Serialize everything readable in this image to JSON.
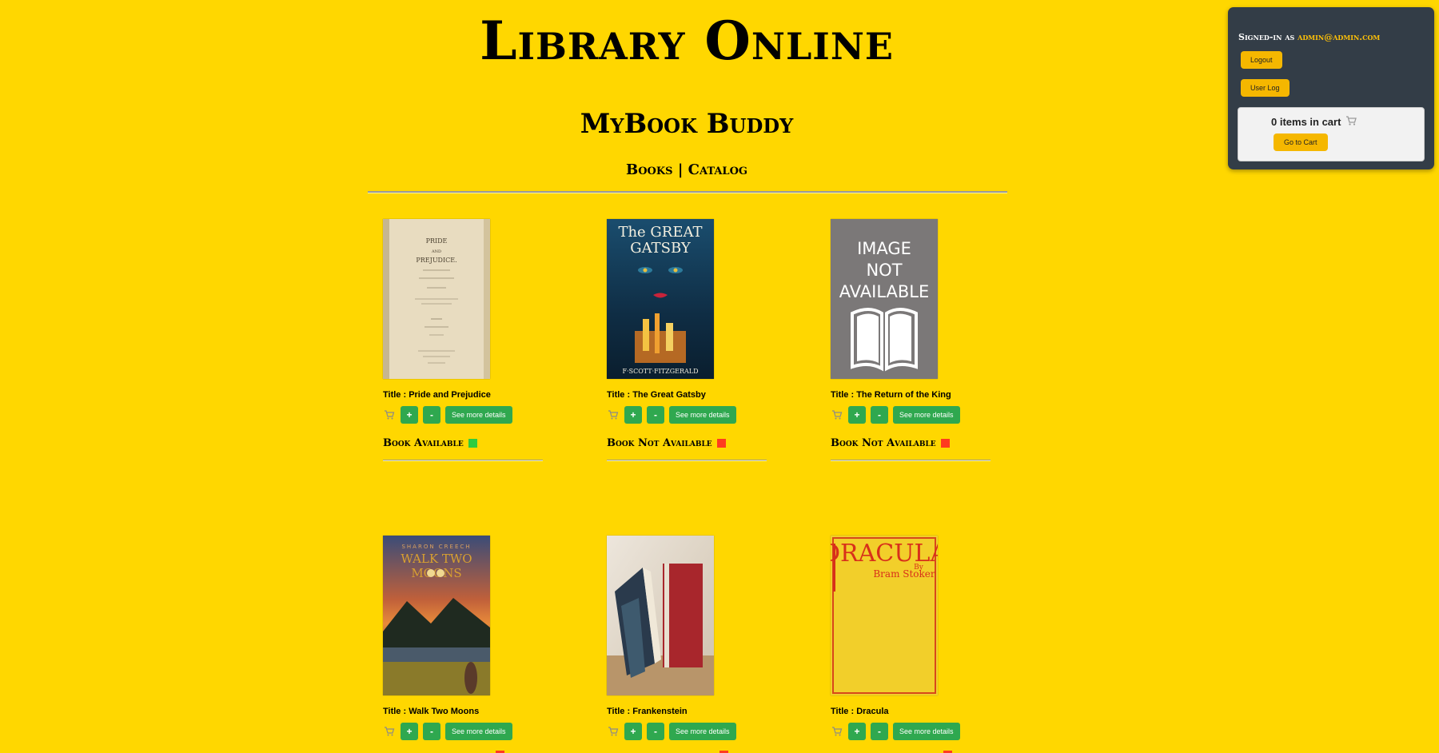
{
  "header": {
    "site_title": "Library Online",
    "subtitle": "MyBook Buddy",
    "nav": {
      "books": "Books",
      "separator": "|",
      "catalog": "Catalog"
    }
  },
  "user_panel": {
    "signed_in_label": "Signed-in as",
    "email": "admin@admin.com",
    "logout_label": "Logout",
    "user_log_label": "User Log",
    "cart_count_text": "0 items in cart",
    "go_to_cart_label": "Go to Cart"
  },
  "book_controls": {
    "plus_label": "+",
    "minus_label": "-",
    "details_label": "See more details"
  },
  "books": [
    {
      "title": "Title : Pride and Prejudice",
      "availability": "Book Available",
      "status_color": "#2ecc40",
      "cover": "pride-and-prejudice-cover"
    },
    {
      "title": "Title : The Great Gatsby",
      "availability": "Book Not Available",
      "status_color": "#ff3b1f",
      "cover": "great-gatsby-cover"
    },
    {
      "title": "Title : The Return of the King",
      "availability": "Book Not Available",
      "status_color": "#ff3b1f",
      "cover": "image-not-available-cover",
      "cover_text": [
        "IMAGE",
        "NOT",
        "AVAILABLE"
      ]
    },
    {
      "title": "Title : Walk Two Moons",
      "availability": "",
      "status_color": "#ff3b1f",
      "cover": "walk-two-moons-cover",
      "cover_text": [
        "SHARON CREECH",
        "WALK TWO",
        "MOONS"
      ]
    },
    {
      "title": "Title : Frankenstein",
      "availability": "",
      "status_color": "#ff3b1f",
      "cover": "frankenstein-cover"
    },
    {
      "title": "Title : Dracula",
      "availability": "",
      "status_color": "#ff3b1f",
      "cover": "dracula-cover",
      "cover_text": [
        "DRACULA",
        "By",
        "Bram Stoker"
      ]
    }
  ],
  "gatsby_cover_text": [
    "The GREAT",
    "GATSBY",
    "F·SCOTT·FITZGERALD"
  ],
  "pride_cover_text": [
    "PRIDE",
    "AND",
    "PREJUDICE."
  ],
  "colors": {
    "page_background": "#FFD700",
    "button_green": "#2fa84f",
    "button_yellow": "#F5B700",
    "panel_dark": "#333d47",
    "available": "#2ecc40",
    "not_available": "#ff3b1f"
  }
}
